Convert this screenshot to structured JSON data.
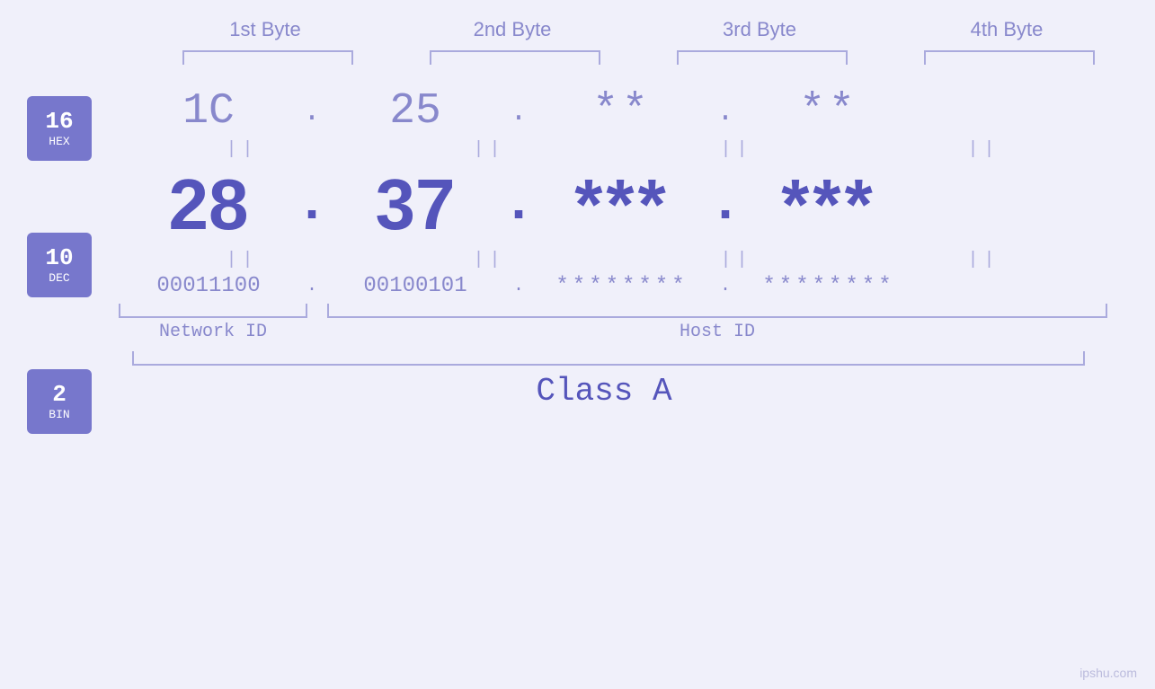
{
  "byteLabels": [
    "1st Byte",
    "2nd Byte",
    "3rd Byte",
    "4th Byte"
  ],
  "badges": [
    {
      "number": "16",
      "label": "HEX"
    },
    {
      "number": "10",
      "label": "DEC"
    },
    {
      "number": "2",
      "label": "BIN"
    }
  ],
  "hexRow": {
    "values": [
      "1C",
      "25",
      "**",
      "**"
    ],
    "dots": [
      ".",
      ".",
      ".",
      ""
    ]
  },
  "decRow": {
    "values": [
      "28",
      "37",
      "***",
      "***"
    ],
    "dots": [
      ".",
      ".",
      ".",
      ""
    ]
  },
  "binRow": {
    "values": [
      "00011100",
      "00100101",
      "********",
      "********"
    ],
    "dots": [
      ".",
      ".",
      ".",
      ""
    ]
  },
  "labels": {
    "networkID": "Network ID",
    "hostID": "Host ID",
    "classA": "Class A"
  },
  "watermark": "ipshu.com"
}
